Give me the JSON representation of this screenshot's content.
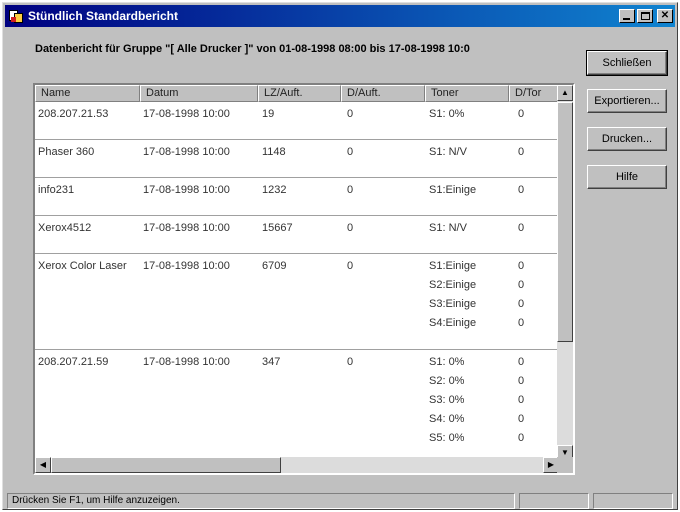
{
  "window": {
    "title": "Stündlich Standardbericht",
    "heading": "Datenbericht für Gruppe \"[ Alle Drucker ]\" von 01-08-1998 08:00 bis 17-08-1998 10:0"
  },
  "table": {
    "columns": [
      "Name",
      "Datum",
      "LZ/Auft.",
      "D/Auft.",
      "Toner",
      "D/Tor"
    ],
    "rows": [
      {
        "name": "208.207.21.53",
        "date": "17-08-1998 10:00",
        "lz": "19",
        "d": "0",
        "toner": [
          "S1: 0%"
        ],
        "dtor": [
          "0"
        ]
      },
      {
        "name": "Phaser 360",
        "date": "17-08-1998 10:00",
        "lz": "1148",
        "d": "0",
        "toner": [
          "S1: N/V"
        ],
        "dtor": [
          "0"
        ]
      },
      {
        "name": "info231",
        "date": "17-08-1998 10:00",
        "lz": "1232",
        "d": "0",
        "toner": [
          "S1:Einige"
        ],
        "dtor": [
          "0"
        ]
      },
      {
        "name": "Xerox4512",
        "date": "17-08-1998 10:00",
        "lz": "15667",
        "d": "0",
        "toner": [
          "S1: N/V"
        ],
        "dtor": [
          "0"
        ]
      },
      {
        "name": "Xerox Color Laser",
        "date": "17-08-1998 10:00",
        "lz": "6709",
        "d": "0",
        "toner": [
          "S1:Einige",
          "S2:Einige",
          "S3:Einige",
          "S4:Einige"
        ],
        "dtor": [
          "0",
          "0",
          "0",
          "0"
        ]
      },
      {
        "name": "208.207.21.59",
        "date": "17-08-1998 10:00",
        "lz": "347",
        "d": "0",
        "toner": [
          "S1: 0%",
          "S2: 0%",
          "S3: 0%",
          "S4: 0%",
          "S5: 0%"
        ],
        "dtor": [
          "0",
          "0",
          "0",
          "0",
          "0"
        ]
      }
    ]
  },
  "buttons": {
    "close": "Schließen",
    "export": "Exportieren...",
    "print": "Drucken...",
    "help": "Hilfe"
  },
  "statusbar": {
    "text": "Drücken Sie F1, um Hilfe anzuzeigen."
  }
}
